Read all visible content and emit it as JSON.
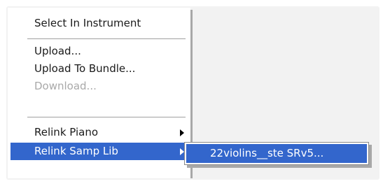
{
  "context_menu": {
    "items": [
      {
        "label": "Select In Instrument"
      },
      {
        "label": "Upload..."
      },
      {
        "label": "Upload To Bundle..."
      },
      {
        "label": "Download..."
      },
      {
        "label": "Relink Piano"
      },
      {
        "label": "Relink Samp Lib"
      }
    ]
  },
  "submenu": {
    "items": [
      {
        "label": "22violins__ste SRv5..."
      }
    ]
  },
  "colors": {
    "highlight": "#3366cc",
    "disabled_text": "#a9a9a9",
    "backdrop": "#f2f2f2"
  },
  "icons": {
    "submenu_arrow": "arrow-right-icon"
  }
}
